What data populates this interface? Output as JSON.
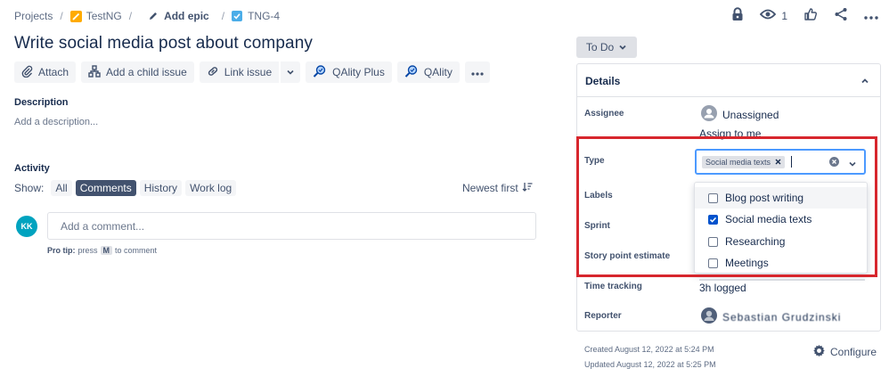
{
  "breadcrumb": {
    "projects": "Projects",
    "sep": "/",
    "project": "TestNG",
    "add_epic": "Add epic",
    "issue_key": "TNG-4"
  },
  "top_actions": {
    "watchers_count": "1"
  },
  "issue": {
    "title": "Write social media post about company"
  },
  "toolbar": {
    "attach": "Attach",
    "add_child": "Add a child issue",
    "link_issue": "Link issue",
    "qality_plus": "QAlity Plus",
    "qality": "QAlity"
  },
  "description": {
    "label": "Description",
    "placeholder": "Add a description..."
  },
  "activity": {
    "label": "Activity",
    "show_label": "Show:",
    "filters": [
      "All",
      "Comments",
      "History",
      "Work log"
    ],
    "active_filter": "Comments",
    "sort": "Newest first"
  },
  "comment": {
    "avatar_initials": "KK",
    "placeholder": "Add a comment...",
    "protip_prefix": "Pro tip:",
    "protip_press": "press",
    "protip_key": "M",
    "protip_suffix": "to comment"
  },
  "status": {
    "label": "To Do"
  },
  "details": {
    "header": "Details",
    "assignee_label": "Assignee",
    "assignee_value": "Unassigned",
    "assign_to_me": "Assign to me",
    "type_label": "Type",
    "type_tag": "Social media texts",
    "labels_label": "Labels",
    "sprint_label": "Sprint",
    "story_points_label": "Story point estimate",
    "time_tracking_label": "Time tracking",
    "time_tracking_value": "3h logged",
    "reporter_label": "Reporter",
    "reporter_value": "Sebastian Grudzinski"
  },
  "type_options": [
    {
      "label": "Blog post writing",
      "checked": false
    },
    {
      "label": "Social media texts",
      "checked": true
    },
    {
      "label": "Researching",
      "checked": false
    },
    {
      "label": "Meetings",
      "checked": false
    }
  ],
  "footer": {
    "created": "Created August 12, 2022 at 5:24 PM",
    "updated": "Updated August 12, 2022 at 5:25 PM",
    "configure": "Configure"
  },
  "colors": {
    "highlight": "#d7262d",
    "focus": "#4c9aff",
    "check": "#0052cc",
    "avatar": "#00a3bf"
  }
}
